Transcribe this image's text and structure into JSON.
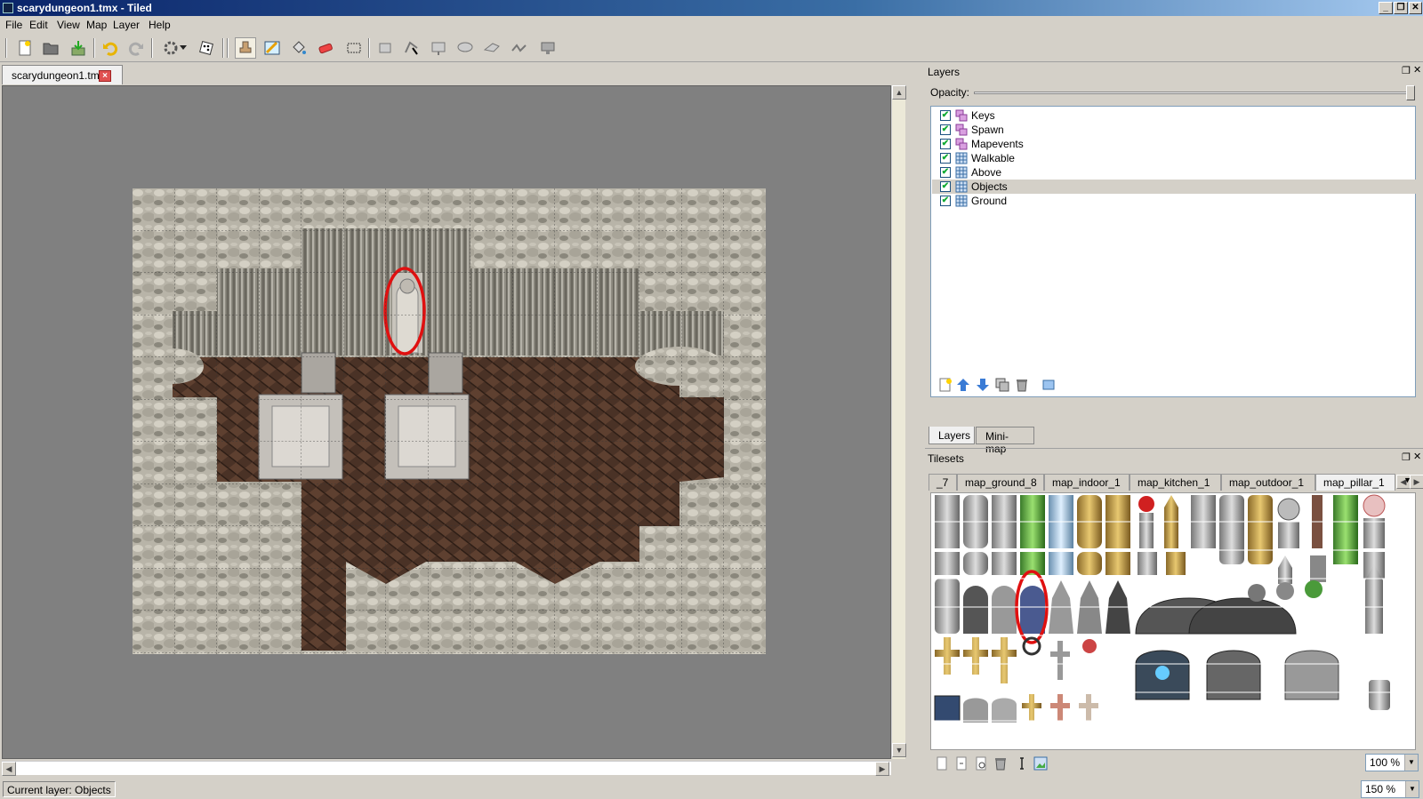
{
  "window": {
    "title": "scarydungeon1.tmx - Tiled",
    "controls": [
      "_",
      "❐",
      "✕"
    ]
  },
  "menu": [
    "File",
    "Edit",
    "View",
    "Map",
    "Layer",
    "Help"
  ],
  "toolbar": {
    "file_buttons": [
      "new-file-icon",
      "open-folder-icon",
      "save-icon"
    ],
    "edit_buttons": [
      "undo-icon",
      "redo-icon"
    ],
    "tools": [
      "stamp-brush-icon",
      "terrain-brush-icon",
      "bucket-fill-icon",
      "eraser-icon",
      "rectangle-select-icon"
    ],
    "object_tools": [
      "select-objects-icon",
      "edit-polygons-icon",
      "insert-rectangle-icon",
      "insert-ellipse-icon",
      "insert-polygon-icon",
      "insert-polyline-icon",
      "insert-tile-icon"
    ]
  },
  "document_tab": {
    "label": "scarydungeon1.tmx",
    "close": "×"
  },
  "layers_panel": {
    "title": "Layers",
    "opacity_label": "Opacity:",
    "opacity_value": 1.0,
    "layers": [
      {
        "name": "Keys",
        "type": "object",
        "visible": true,
        "selected": false
      },
      {
        "name": "Spawn",
        "type": "object",
        "visible": true,
        "selected": false
      },
      {
        "name": "Mapevents",
        "type": "object",
        "visible": true,
        "selected": false
      },
      {
        "name": "Walkable",
        "type": "tile",
        "visible": true,
        "selected": false
      },
      {
        "name": "Above",
        "type": "tile",
        "visible": true,
        "selected": false
      },
      {
        "name": "Objects",
        "type": "tile",
        "visible": true,
        "selected": true
      },
      {
        "name": "Ground",
        "type": "tile",
        "visible": true,
        "selected": false
      }
    ],
    "tabs": [
      "Layers",
      "Mini-map"
    ],
    "buttons": [
      "add-layer-icon",
      "raise-layer-icon",
      "lower-layer-icon",
      "duplicate-layer-icon",
      "delete-layer-icon",
      "layer-properties-icon"
    ]
  },
  "tilesets_panel": {
    "title": "Tilesets",
    "tabs": [
      "_7",
      "map_ground_8",
      "map_indoor_1",
      "map_kitchen_1",
      "map_outdoor_1",
      "map_pillar_1"
    ],
    "active_tab": "map_pillar_1",
    "zoom": "100 %",
    "buttons": [
      "new-tileset-icon",
      "import-tileset-icon",
      "tileset-properties-icon",
      "remove-tileset-icon",
      "edit-terrain-icon",
      "import-image-icon"
    ]
  },
  "status": {
    "current_layer": "Current layer: Objects",
    "zoom": "150 %"
  },
  "colors": {
    "title_gradient_start": "#0a246a",
    "highlight_ellipse": "#e01010",
    "map_background": "#808080"
  }
}
